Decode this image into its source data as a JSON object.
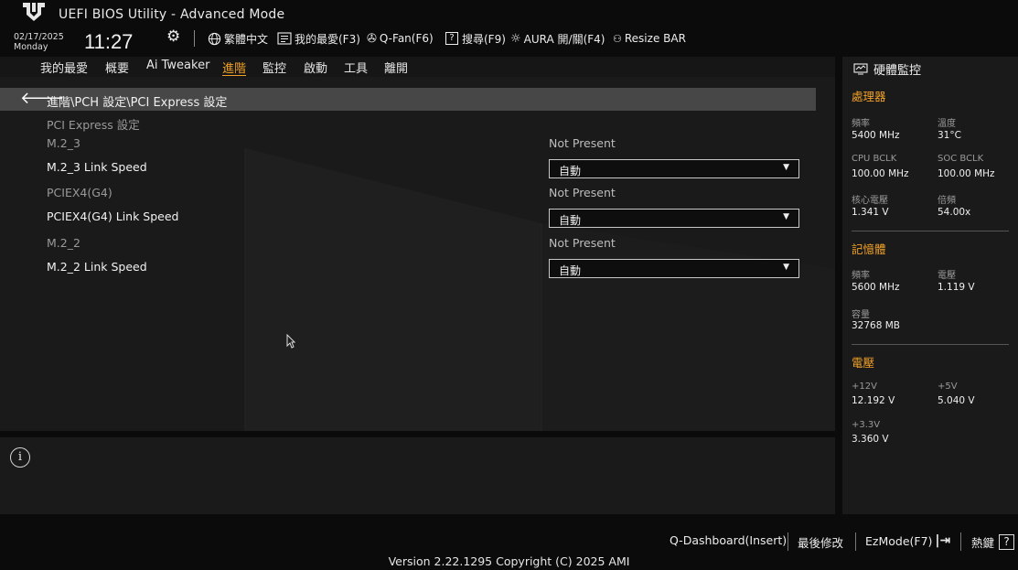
{
  "header": {
    "logo_icon": "tuf-logo-icon",
    "title": "UEFI BIOS Utility - Advanced Mode",
    "date": "02/17/2025",
    "weekday": "Monday",
    "time": "11:27",
    "settings_icon": "gear-icon",
    "items": [
      {
        "icon": "globe-icon",
        "label": "繁體中文"
      },
      {
        "icon": "favorites-list-icon",
        "label": "我的最愛(F3)"
      },
      {
        "icon": "fan-icon",
        "label": "Q-Fan(F6)"
      },
      {
        "icon": "help-search-icon",
        "label": "搜尋(F9)"
      },
      {
        "icon": "aura-light-icon",
        "label": "AURA 開/關(F4)"
      },
      {
        "icon": "resize-bar-icon",
        "label": "Resize BAR"
      }
    ]
  },
  "tabs": [
    {
      "label": "我的最愛"
    },
    {
      "label": "概要"
    },
    {
      "label": "Ai Tweaker"
    },
    {
      "label": "進階",
      "active": true
    },
    {
      "label": "監控"
    },
    {
      "label": "啟動"
    },
    {
      "label": "工具"
    },
    {
      "label": "離開"
    }
  ],
  "breadcrumb": "進階\\PCH 設定\\PCI Express 設定",
  "section_title": "PCI Express 設定",
  "settings": [
    {
      "device": "M.2_3",
      "status": "Not Present",
      "label": "M.2_3 Link Speed",
      "value": "自動"
    },
    {
      "device": "PCIEX4(G4)",
      "status": "Not Present",
      "label": "PCIEX4(G4) Link Speed",
      "value": "自動"
    },
    {
      "device": "M.2_2",
      "status": "Not Present",
      "label": "M.2_2 Link Speed",
      "value": "自動"
    }
  ],
  "hw_monitor": {
    "title": "硬體監控",
    "cpu": {
      "title": "處理器",
      "freq_label": "頻率",
      "freq": "5400 MHz",
      "temp_label": "溫度",
      "temp": "31°C",
      "bclk_label": "CPU BCLK",
      "bclk": "100.00 MHz",
      "soc_label": "SOC BCLK",
      "soc": "100.00 MHz",
      "vcore_label": "核心電壓",
      "vcore": "1.341 V",
      "ratio_label": "倍頻",
      "ratio": "54.00x"
    },
    "memory": {
      "title": "記憶體",
      "freq_label": "頻率",
      "freq": "5600 MHz",
      "volt_label": "電壓",
      "volt": "1.119 V",
      "cap_label": "容量",
      "cap": "32768 MB"
    },
    "voltage": {
      "title": "電壓",
      "v12_label": "+12V",
      "v12": "12.192 V",
      "v5_label": "+5V",
      "v5": "5.040 V",
      "v33_label": "+3.3V",
      "v33": "3.360 V"
    }
  },
  "footer": {
    "qdash": "Q-Dashboard(Insert)",
    "last_modified": "最後修改",
    "ezmode": "EzMode(F7)",
    "hotkeys": "熱鍵",
    "hotkeys_box": "?",
    "version": "Version 2.22.1295 Copyright (C) 2025 AMI"
  },
  "colors": {
    "accent": "#f0a028",
    "background": "#0b0b0b",
    "panel": "#1a1a1a"
  }
}
